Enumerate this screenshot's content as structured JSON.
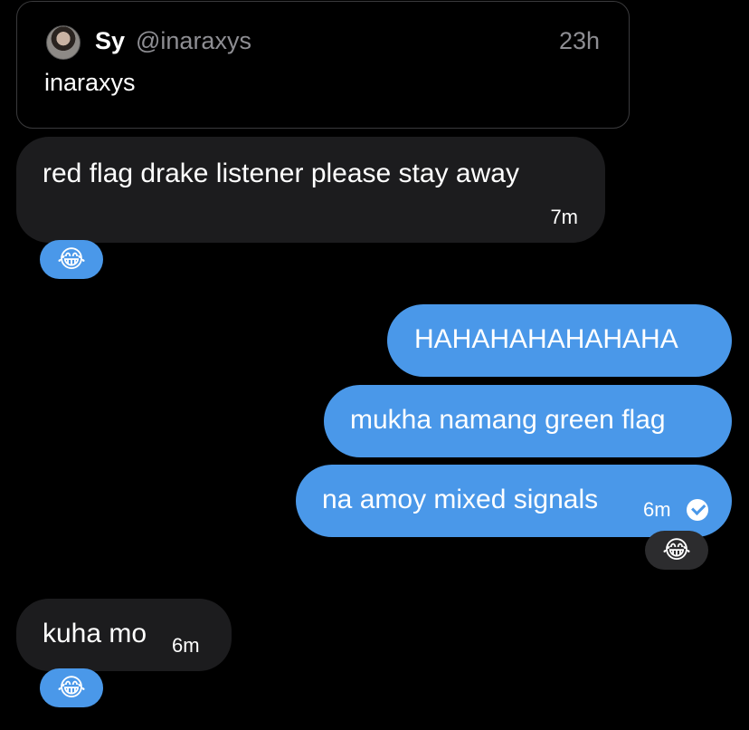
{
  "quoted_story": {
    "display_name": "Sy",
    "handle": "@inaraxys",
    "time": "23h",
    "text": "inaraxys"
  },
  "messages": [
    {
      "direction": "incoming",
      "text": "red flag drake listener please stay away",
      "time": "7m"
    },
    {
      "direction": "outgoing",
      "text": "HAHAHAHAHAHAHA"
    },
    {
      "direction": "outgoing",
      "text": "mukha namang green flag"
    },
    {
      "direction": "outgoing",
      "text": "na amoy mixed signals",
      "time": "6m",
      "status_icon": "read-check-icon"
    },
    {
      "direction": "incoming",
      "text": "kuha mo",
      "time": "6m"
    }
  ],
  "reactions": [
    {
      "emoji": "😂",
      "icon": "face-with-tears-of-joy-icon",
      "background": "#4a98e9"
    },
    {
      "emoji": "😂",
      "icon": "face-with-tears-of-joy-icon",
      "background": "#2c2c2e"
    },
    {
      "emoji": "😂",
      "icon": "face-with-tears-of-joy-icon",
      "background": "#4a98e9"
    }
  ],
  "colors": {
    "background": "#000000",
    "incoming_bubble": "#1c1c1e",
    "outgoing_bubble": "#4a98e9",
    "muted_text": "#8e8e93"
  }
}
